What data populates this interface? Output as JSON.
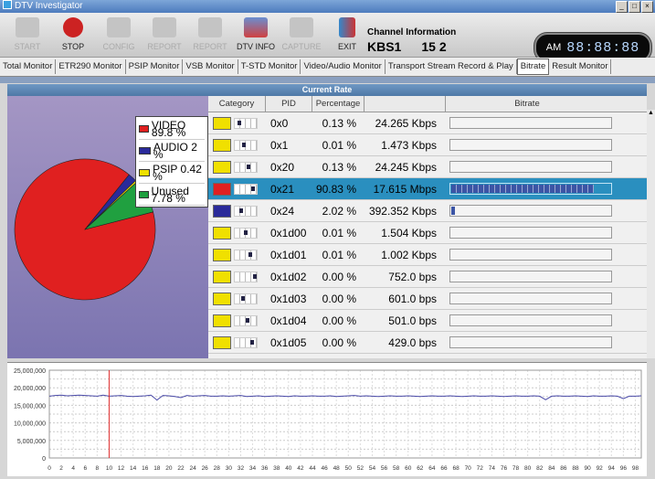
{
  "window": {
    "title": "DTV Investigator"
  },
  "toolbar": {
    "buttons": [
      {
        "label": "START",
        "color": "#b0b0b0"
      },
      {
        "label": "STOP",
        "color": "#cc2222"
      },
      {
        "label": "CONFIG",
        "color": "#b0b0b0"
      },
      {
        "label": "REPORT",
        "color": "#b0b0b0"
      },
      {
        "label": "REPORT",
        "color": "#b0b0b0"
      },
      {
        "label": "DTV INFO",
        "color": "#4466aa"
      },
      {
        "label": "CAPTURE",
        "color": "#b0b0b0"
      },
      {
        "label": "EXIT",
        "color": "#3388cc"
      }
    ]
  },
  "channel": {
    "title": "Channel Information",
    "name": "KBS1",
    "number": "15 2"
  },
  "clock": {
    "ampm": "AM",
    "time": "88:88:88"
  },
  "tabs": [
    "Total Monitor",
    "ETR290 Monitor",
    "PSIP Monitor",
    "VSB Monitor",
    "T-STD Monitor",
    "Video/Audio Monitor",
    "Transport Stream Record & Play",
    "Bitrate",
    "Result Monitor"
  ],
  "selected_tab": "Bitrate",
  "panel": {
    "title": "Current Rate"
  },
  "legend": [
    {
      "label": "VIDEO 89.8 %",
      "color": "#e02020"
    },
    {
      "label": "AUDIO 2 %",
      "color": "#2a2a9a"
    },
    {
      "label": "PSIP 0.42 %",
      "color": "#f0e000"
    },
    {
      "label": "Unused 7.78 %",
      "color": "#20a040"
    }
  ],
  "chart_data": [
    {
      "type": "pie",
      "values": [
        89.8,
        2,
        0.42,
        7.78
      ],
      "categories": [
        "VIDEO",
        "AUDIO",
        "PSIP",
        "Unused"
      ],
      "colors": [
        "#e02020",
        "#2a2a9a",
        "#f0e000",
        "#20a040"
      ]
    },
    {
      "type": "line",
      "yticks": [
        "25,000,000",
        "20,000,000",
        "15,000,000",
        "10,000,000",
        "5,000,000",
        "0"
      ],
      "ylim": [
        0,
        25000000
      ],
      "xticks": [
        "0",
        "2",
        "4",
        "6",
        "8",
        "10",
        "12",
        "14",
        "16",
        "18",
        "20",
        "22",
        "24",
        "26",
        "28",
        "30",
        "32",
        "34",
        "36",
        "38",
        "40",
        "42",
        "44",
        "46",
        "48",
        "50",
        "52",
        "54",
        "56",
        "58",
        "60",
        "62",
        "64",
        "66",
        "68",
        "70",
        "72",
        "74",
        "76",
        "78",
        "80",
        "82",
        "84",
        "86",
        "88",
        "90",
        "92",
        "94",
        "96",
        "98"
      ],
      "xlim": [
        0,
        99
      ],
      "series": [
        {
          "color": "#4a4aa8",
          "values": [
            17.6,
            17.8,
            17.9,
            17.7,
            17.8,
            17.9,
            17.8,
            17.7,
            17.6,
            17.9,
            17.6,
            17.7,
            17.8,
            17.6,
            17.5,
            17.6,
            17.7,
            17.9,
            16.5,
            17.8,
            17.7,
            17.5,
            17.2,
            17.8,
            17.6,
            17.7,
            17.8,
            17.6,
            17.6,
            17.7,
            17.6,
            17.7,
            17.8,
            17.5,
            17.6,
            17.7,
            17.5,
            17.6,
            17.7,
            17.6,
            17.5,
            17.7,
            17.6,
            17.6,
            17.7,
            17.6,
            17.6,
            17.7,
            17.5,
            17.6,
            17.7,
            17.8,
            17.6,
            17.7,
            17.6,
            17.5,
            17.6,
            17.7,
            17.6,
            17.6,
            17.7,
            17.6,
            17.5,
            17.6,
            17.7,
            17.6,
            17.6,
            17.7,
            17.6,
            17.5,
            17.6,
            17.7,
            17.6,
            17.6,
            17.7,
            17.6,
            17.5,
            17.6,
            17.7,
            17.6,
            17.6,
            17.7,
            17.6,
            16.6,
            17.6,
            17.7,
            17.6,
            17.6,
            17.7,
            17.6,
            17.5,
            17.7,
            17.6,
            17.6,
            17.7,
            17.6,
            16.9,
            17.6,
            17.6,
            17.7
          ]
        }
      ],
      "marker_x": 10
    }
  ],
  "table": {
    "headers": [
      "Category",
      "PID",
      "Percentage",
      "Bitrate",
      "Bitrate"
    ],
    "rows": [
      {
        "color": "#f0e000",
        "pid": "0x0",
        "pct": "0.13 %",
        "rate": "24.265 Kbps",
        "fill": 0.0013,
        "sel": false
      },
      {
        "color": "#f0e000",
        "pid": "0x1",
        "pct": "0.01 %",
        "rate": "1.473 Kbps",
        "fill": 0.0001,
        "sel": false
      },
      {
        "color": "#f0e000",
        "pid": "0x20",
        "pct": "0.13 %",
        "rate": "24.245 Kbps",
        "fill": 0.0013,
        "sel": false
      },
      {
        "color": "#e02020",
        "pid": "0x21",
        "pct": "90.83 %",
        "rate": "17.615 Mbps",
        "fill": 0.9083,
        "sel": true
      },
      {
        "color": "#2a2a9a",
        "pid": "0x24",
        "pct": "2.02 %",
        "rate": "392.352 Kbps",
        "fill": 0.0202,
        "sel": false
      },
      {
        "color": "#f0e000",
        "pid": "0x1d00",
        "pct": "0.01 %",
        "rate": "1.504 Kbps",
        "fill": 0.0001,
        "sel": false
      },
      {
        "color": "#f0e000",
        "pid": "0x1d01",
        "pct": "0.01 %",
        "rate": "1.002 Kbps",
        "fill": 0.0001,
        "sel": false
      },
      {
        "color": "#f0e000",
        "pid": "0x1d02",
        "pct": "0.00 %",
        "rate": "752.0 bps",
        "fill": 0,
        "sel": false
      },
      {
        "color": "#f0e000",
        "pid": "0x1d03",
        "pct": "0.00 %",
        "rate": "601.0 bps",
        "fill": 0,
        "sel": false
      },
      {
        "color": "#f0e000",
        "pid": "0x1d04",
        "pct": "0.00 %",
        "rate": "501.0 bps",
        "fill": 0,
        "sel": false
      },
      {
        "color": "#f0e000",
        "pid": "0x1d05",
        "pct": "0.00 %",
        "rate": "429.0 bps",
        "fill": 0,
        "sel": false
      }
    ]
  }
}
